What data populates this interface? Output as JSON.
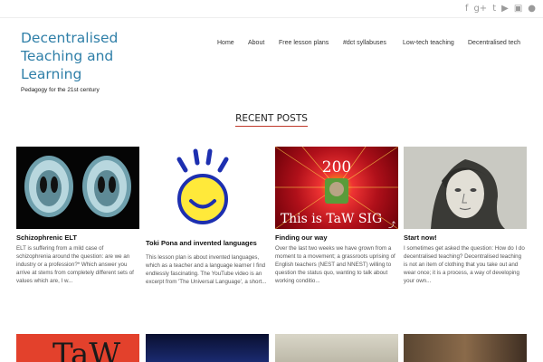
{
  "social_icons": [
    "facebook-icon",
    "google-plus-icon",
    "twitter-icon",
    "youtube-icon",
    "instagram-icon",
    "flickr-icon"
  ],
  "social_glyphs": [
    "f",
    "g+",
    "t",
    "▶",
    "▣",
    "●"
  ],
  "site": {
    "title_lines": [
      "Decentralised",
      "Teaching and",
      "Learning"
    ],
    "tagline": "Pedagogy for the 21st century"
  },
  "nav": [
    "Home",
    "About",
    "Free lesson plans",
    "#dct syllabuses",
    "Low-tech teaching",
    "Decentralised tech"
  ],
  "section_title": "RECENT POSTS",
  "posts": [
    {
      "title": "Schizophrenic ELT",
      "excerpt": "ELT is suffering from a mild case of schizophrenia around the question: are we an industry or a profession?* Which answer you arrive at stems from completely different sets of values which are, I w..."
    },
    {
      "title": "Toki Pona and invented languages",
      "excerpt": "This lesson plan is about invented languages, which as a teacher and a language learner I find endlessly fascinating. The YouTube video is an excerpt from 'The Universal Language', a short..."
    },
    {
      "title": "Finding our way",
      "excerpt": "Over the last two weeks we have grown from a moment to a movement; a grassroots uprising of English teachers (NEST and NNEST) willing to question the status quo, wanting to talk about working conditio..."
    },
    {
      "title": "Start now!",
      "excerpt": "I sometimes get asked the question: How do I do decentralised teaching? Decentralised teaching is not an item of clothing that you take out and wear once; it is a process, a way of developing your own..."
    }
  ],
  "thumb_texts": {
    "sig_number": "200",
    "sig_caption": "This is TaW SIG",
    "row2_text": "TaW"
  }
}
